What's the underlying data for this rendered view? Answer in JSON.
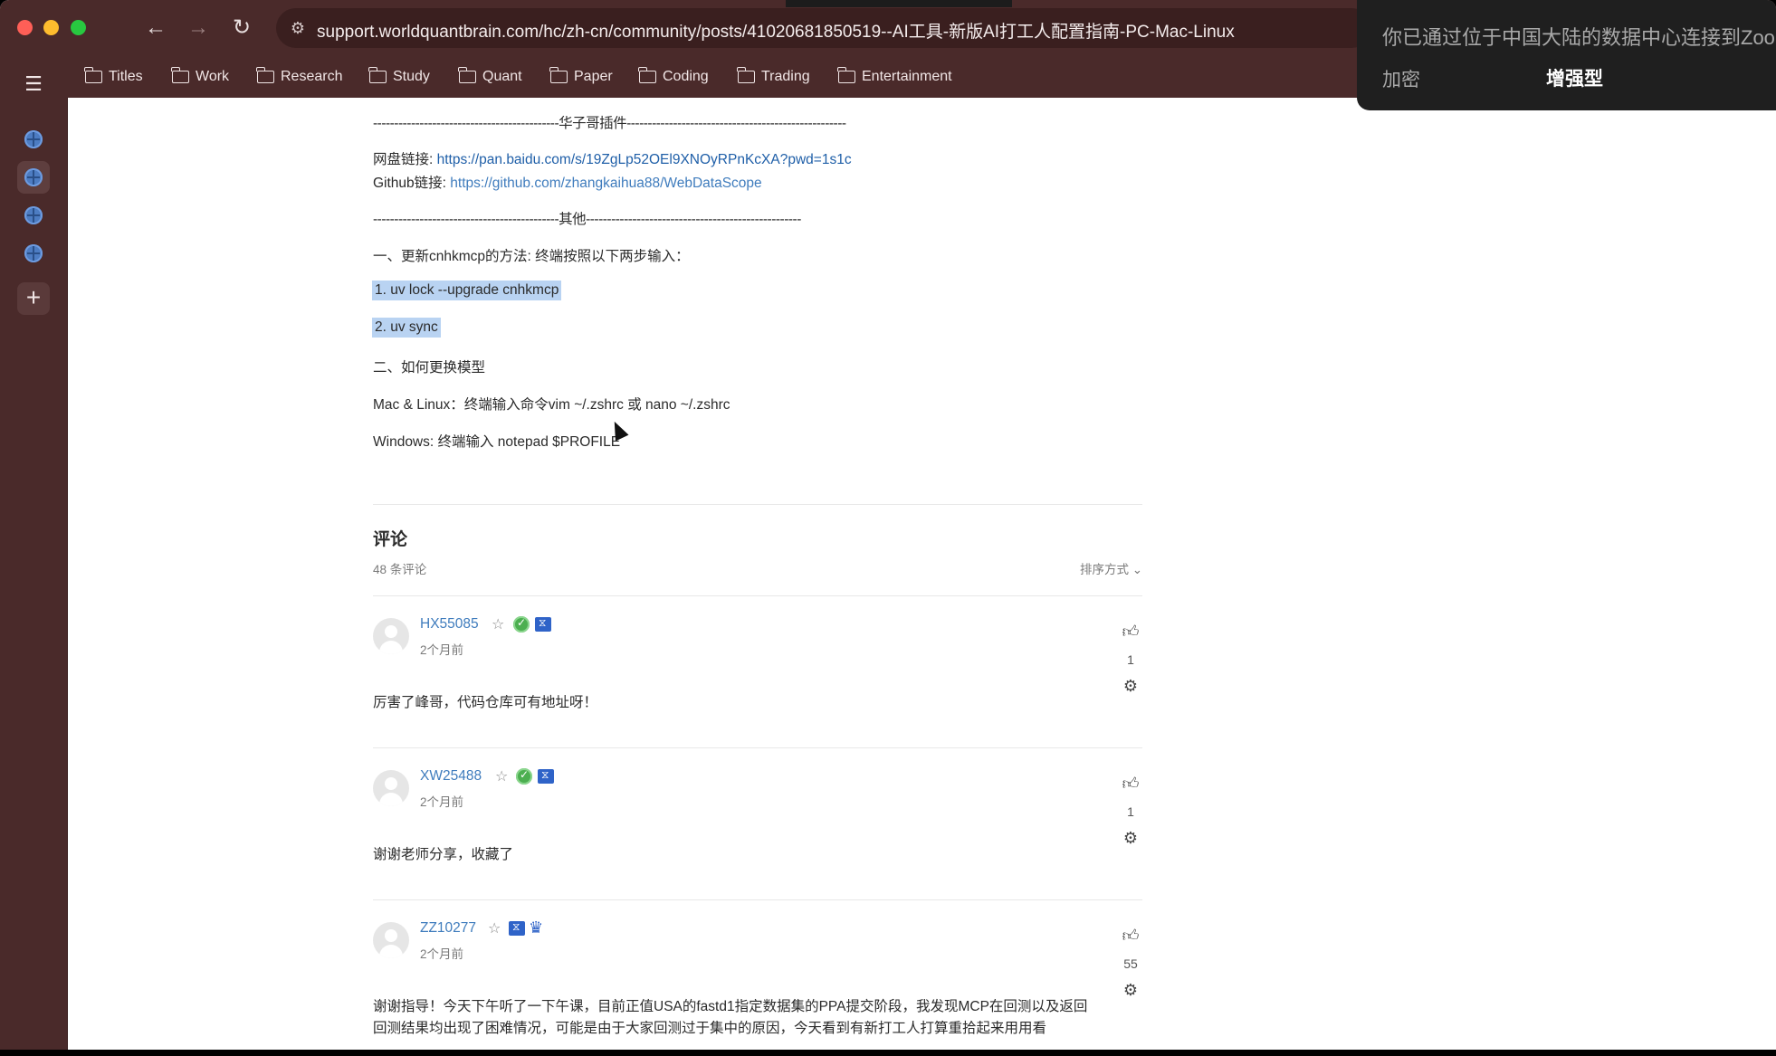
{
  "browser": {
    "url": "support.worldquantbrain.com/hc/zh-cn/community/posts/41020681850519--AI工具-新版AI打工人配置指南-PC-Mac-Linux",
    "nav": {
      "back": "←",
      "forward": "→",
      "reload": "↻"
    }
  },
  "bookmarks": [
    "Titles",
    "Work",
    "Research",
    "Study",
    "Quant",
    "Paper",
    "Coding",
    "Trading",
    "Entertainment"
  ],
  "article": {
    "divider_plugin": "--------------------------------------------华子哥插件----------------------------------------------------",
    "pan_label": "网盘链接: ",
    "pan_url": "https://pan.baidu.com/s/19ZgLp52OEl9XNOyRPnKcXA?pwd=1s1c",
    "github_label": "Github链接: ",
    "github_url": "https://github.com/zhangkaihua88/WebDataScope",
    "divider_other": "--------------------------------------------其他---------------------------------------------------",
    "section1": "一、更新cnhkmcp的方法: 终端按照以下两步输入：",
    "step1": "1. uv lock --upgrade cnhkmcp",
    "step2": "2. uv sync",
    "section2": "二、如何更换模型",
    "mac_line": "Mac & Linux：终端输入命令vim ~/.zshrc 或 nano ~/.zshrc",
    "win_line": "Windows: 终端输入 notepad $PROFILE"
  },
  "comments": {
    "title": "评论",
    "count": "48 条评论",
    "sort": "排序方式 ⌄",
    "items": [
      {
        "user": "HX55085",
        "time": "2个月前",
        "text": "厉害了峰哥，代码仓库可有地址呀！",
        "votes": "1"
      },
      {
        "user": "XW25488",
        "time": "2个月前",
        "text": "谢谢老师分享，收藏了",
        "votes": "1"
      },
      {
        "user": "ZZ10277",
        "time": "2个月前",
        "text": "谢谢指导！今天下午听了一下午课，目前正值USA的fastd1指定数据集的PPA提交阶段，我发现MCP在回测以及返回回测结果均出现了困难情况，可能是由于大家回测过于集中的原因，今天看到有新打工人打算重拾起来用用看",
        "votes": "55"
      }
    ]
  },
  "vpn_popup": {
    "message": "你已通过位于中国大陆的数据中心连接到Zoom",
    "label_encrypt": "加密",
    "value_encrypt": "增强型"
  },
  "icons": {
    "thumb": "thumbs-up-icon",
    "gear": "gear-icon",
    "star": "star-icon"
  }
}
